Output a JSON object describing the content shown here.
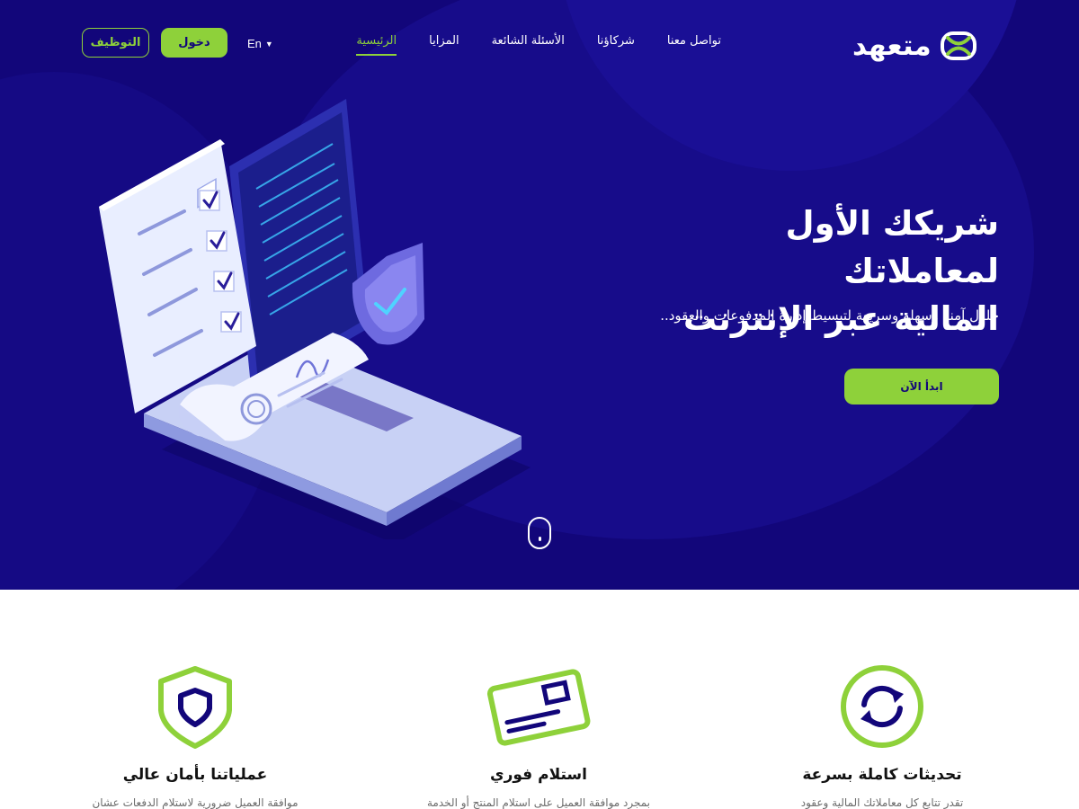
{
  "brand": {
    "logo_text": "متعهد"
  },
  "nav": {
    "items": [
      {
        "label": "الرئيسية",
        "active": true
      },
      {
        "label": "المزايا",
        "active": false
      },
      {
        "label": "الأسئلة الشائعة",
        "active": false
      },
      {
        "label": "شركاؤنا",
        "active": false
      },
      {
        "label": "تواصل معنا",
        "active": false
      }
    ],
    "lang_label": "En",
    "login_label": "دخول",
    "hire_label": "التوظيف"
  },
  "hero": {
    "title_line1": "شريكك الأول لمعاملاتك",
    "title_line2": "المالية عبر الإنترنت",
    "subtitle": "حلول آمنة وسهلة وسريعة لتبسيط إدارة المدفوعات والعقود..",
    "cta_label": "ابدأ الآن"
  },
  "features": [
    {
      "icon": "sync-icon",
      "title": "تحديثات كاملة بسرعة",
      "desc": "تقدر تتابع كل معاملاتك المالية وعقود"
    },
    {
      "icon": "card-icon",
      "title": "استلام فوري",
      "desc": "بمجرد موافقة العميل على استلام المنتج أو الخدمة"
    },
    {
      "icon": "shield-icon",
      "title": "عملياتنا بأمان عالي",
      "desc": "موافقة العميل ضرورية لاستلام الدفعات عشان"
    }
  ],
  "colors": {
    "hero_bg": "#12067a",
    "accent": "#8ed13a",
    "text_dark": "#111111",
    "text_muted": "#6b6b6b"
  }
}
